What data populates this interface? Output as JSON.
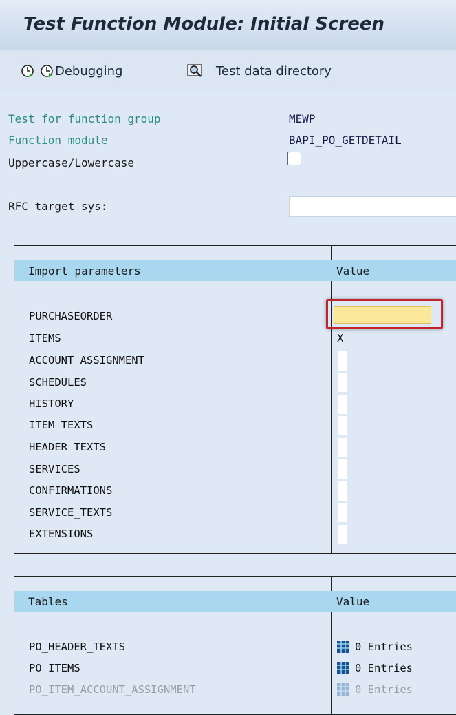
{
  "window": {
    "title": "Test Function Module: Initial Screen"
  },
  "toolbar": {
    "execute_icon": "clock-execute-icon",
    "debugging_label": "Debugging",
    "test_data_label": "Test data directory"
  },
  "header": {
    "function_group_label": "Test for function group",
    "function_group_value": "MEWP",
    "function_module_label": "Function module",
    "function_module_value": "BAPI_PO_GETDETAIL",
    "uppercase_label": "Uppercase/Lowercase",
    "uppercase_checked": false,
    "rfc_label": "RFC target sys:",
    "rfc_value": ""
  },
  "import_table": {
    "col1": "Import parameters",
    "col2": "Value",
    "rows": [
      {
        "name": "PURCHASEORDER",
        "value": ""
      },
      {
        "name": "ITEMS",
        "value": "X"
      },
      {
        "name": "ACCOUNT_ASSIGNMENT",
        "value": ""
      },
      {
        "name": "SCHEDULES",
        "value": ""
      },
      {
        "name": "HISTORY",
        "value": ""
      },
      {
        "name": "ITEM_TEXTS",
        "value": ""
      },
      {
        "name": "HEADER_TEXTS",
        "value": ""
      },
      {
        "name": "SERVICES",
        "value": ""
      },
      {
        "name": "CONFIRMATIONS",
        "value": ""
      },
      {
        "name": "SERVICE_TEXTS",
        "value": ""
      },
      {
        "name": "EXTENSIONS",
        "value": ""
      }
    ]
  },
  "tables_table": {
    "col1": "Tables",
    "col2": "Value",
    "rows": [
      {
        "name": "PO_HEADER_TEXTS",
        "value": "0 Entries"
      },
      {
        "name": "PO_ITEMS",
        "value": "0 Entries"
      },
      {
        "name": "PO_ITEM_ACCOUNT_ASSIGNMENT",
        "value": "0 Entries"
      }
    ]
  },
  "colors": {
    "header_bg": "#a9d7ef",
    "focus_border": "#c0242c",
    "label_green": "#2f8a86"
  }
}
